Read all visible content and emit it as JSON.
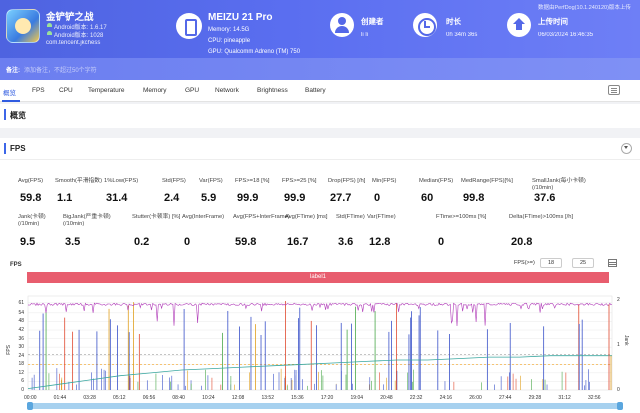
{
  "header": {
    "app": {
      "name": "金铲铲之战",
      "android_version": "Android版本: 1.6.17",
      "android_version_code": "Android版本: 1028",
      "package": "com.tencent.jkchess"
    },
    "device": {
      "name": "MEIZU 21 Pro",
      "memory": "Memory: 14.5G",
      "cpu": "CPU: pineapple",
      "gpu": "GPU: Qualcomm Adreno (TM) 750"
    },
    "creator": {
      "label": "创建者",
      "value": "li li"
    },
    "duration": {
      "label": "时长",
      "value": "0h 34m 36s"
    },
    "upload": {
      "label": "上传时间",
      "value": "06/03/2024 16:46:35",
      "client_version": "数据由PerfDog(10.1.240120)版本上传"
    },
    "note": {
      "label": "备注:",
      "placeholder": "添加备注，不超过50个字符"
    }
  },
  "tabs": [
    "概览",
    "FPS",
    "CPU",
    "Temperature",
    "Memory",
    "GPU",
    "Network",
    "Brightness",
    "Battery"
  ],
  "sections": {
    "overview": "概览",
    "fps": "FPS"
  },
  "metrics_row1": [
    {
      "label": "Avg(FPS)",
      "value": "59.8"
    },
    {
      "label": "Smooth(平滑指数)",
      "value": "1.1"
    },
    {
      "label": "1%Low(FPS)",
      "value": "31.4"
    },
    {
      "label": "Std(FPS)",
      "value": "2.4"
    },
    {
      "label": "Var(FPS)",
      "value": "5.9"
    },
    {
      "label": "FPS>=18 [%]",
      "value": "99.9"
    },
    {
      "label": "FPS>=25 [%]",
      "value": "99.9"
    },
    {
      "label": "Drop(FPS) [/h]",
      "value": "27.7"
    },
    {
      "label": "Min(FPS)",
      "value": "0"
    },
    {
      "label": "Median(FPS)",
      "value": "60"
    },
    {
      "label": "MedRange(FPS)[%]",
      "value": "99.8"
    },
    {
      "label": "SmallJank(每小卡顿)\n(/10min)",
      "value": "37.6"
    }
  ],
  "metrics_row2": [
    {
      "label": "Jank(卡顿)\n(/10min)",
      "value": "9.5"
    },
    {
      "label": "BigJank(严重卡顿)\n(/10min)",
      "value": "3.5"
    },
    {
      "label": "Stutter(卡顿率) [%]",
      "value": "0.2"
    },
    {
      "label": "Avg(InterFrame)",
      "value": "0"
    },
    {
      "label": "Avg(FPS+InterFrame)",
      "value": "59.8"
    },
    {
      "label": "Avg(FTime) [ms]",
      "value": "16.7"
    },
    {
      "label": "Std(FTime)",
      "value": "3.6"
    },
    {
      "label": "Var(FTime)",
      "value": "12.8"
    },
    {
      "label": "FTime>=100ms [%]",
      "value": "0"
    },
    {
      "label": "Delta(FTime)>100ms [/h]",
      "value": "20.8"
    }
  ],
  "chart_controls": {
    "title": "FPS",
    "threshold_label": "FPS(>=)",
    "threshold_1": "18",
    "threshold_2": "25",
    "marker_label": "label1",
    "y_axis_label": "FPS",
    "y2_axis_label": "Jank"
  },
  "chart_data": {
    "type": "line",
    "title": "FPS",
    "ylabel": "FPS",
    "y2label": "Jank",
    "ylim": [
      0,
      63
    ],
    "yticks": [
      0,
      6,
      12,
      18,
      24,
      30,
      36,
      42,
      48,
      54,
      61
    ],
    "y2ticks": [
      0,
      1,
      2
    ],
    "x": [
      "00:00",
      "01:44",
      "03:28",
      "05:12",
      "06:56",
      "08:40",
      "10:24",
      "12:08",
      "13:52",
      "15:36",
      "17:20",
      "19:04",
      "20:48",
      "22:32",
      "24:16",
      "26:00",
      "27:44",
      "29:28",
      "31:12",
      "32:56"
    ],
    "series": [
      {
        "name": "FPS",
        "color": "#b03bb8",
        "values": [
          60,
          60,
          60,
          60,
          60,
          60,
          60,
          60,
          60,
          60,
          60,
          60,
          60,
          60,
          60,
          60,
          60,
          60,
          60,
          60
        ],
        "min_dips": [
          44,
          46,
          45,
          47,
          43,
          46,
          44,
          45,
          47,
          44
        ]
      },
      {
        "name": "Jank",
        "color": "#3a52c9"
      },
      {
        "name": "BigJank",
        "color": "#e04a2f"
      },
      {
        "name": "FTime",
        "color": "#3aa7a0",
        "values": [
          1,
          4,
          7,
          10,
          12,
          14,
          15,
          16,
          17,
          18,
          19,
          20,
          21,
          21,
          22,
          23,
          23,
          24,
          24,
          24
        ]
      }
    ],
    "grid": true
  }
}
